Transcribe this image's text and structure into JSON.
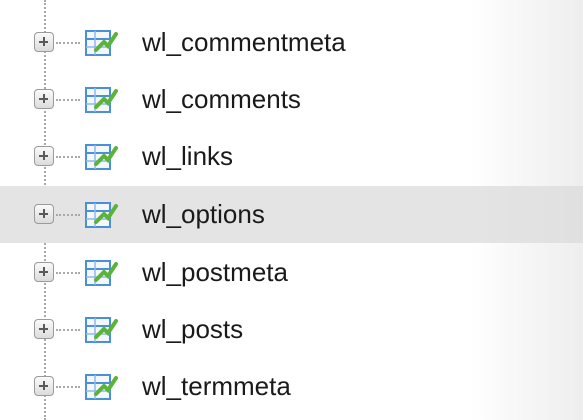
{
  "tree": {
    "items": [
      {
        "label": "wl_commentmeta",
        "selected": false
      },
      {
        "label": "wl_comments",
        "selected": false
      },
      {
        "label": "wl_links",
        "selected": false
      },
      {
        "label": "wl_options",
        "selected": true
      },
      {
        "label": "wl_postmeta",
        "selected": false
      },
      {
        "label": "wl_posts",
        "selected": false
      },
      {
        "label": "wl_termmeta",
        "selected": false
      }
    ],
    "expander_icon": "plus-box-icon",
    "item_icon": "table-icon"
  },
  "colors": {
    "selected_row": "#e4e4e4",
    "tree_line": "#a9a9a9",
    "icon_blue": "#4a8fd9",
    "icon_green": "#5cb338"
  }
}
